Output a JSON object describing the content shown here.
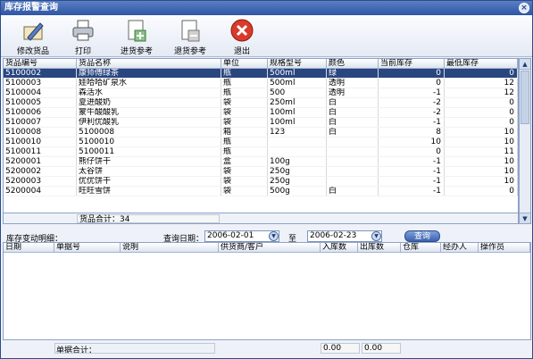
{
  "window": {
    "title": "库存报警查询",
    "close_icon": "close-icon"
  },
  "toolbar": {
    "buttons": [
      {
        "label": "修改货品",
        "icon": "edit-goods-icon"
      },
      {
        "label": "打印",
        "icon": "printer-icon"
      },
      {
        "label": "进货参考",
        "icon": "add-document-icon"
      },
      {
        "label": "退货参考",
        "icon": "remove-document-icon"
      },
      {
        "label": "退出",
        "icon": "exit-icon"
      }
    ]
  },
  "grid": {
    "columns": [
      "货品编号",
      "货品名称",
      "单位",
      "规格型号",
      "颜色",
      "当前库存",
      "最低库存"
    ],
    "rows": [
      [
        "5100002",
        "康师傅绿茶",
        "瓶",
        "500ml",
        "绿",
        "0",
        "0"
      ],
      [
        "5100003",
        "娃哈哈矿泉水",
        "瓶",
        "500ml",
        "透明",
        "0",
        "12"
      ],
      [
        "5100004",
        "森活水",
        "瓶",
        "500",
        "透明",
        "-1",
        "12"
      ],
      [
        "5100005",
        "夏进酸奶",
        "袋",
        "250ml",
        "白",
        "-2",
        "0"
      ],
      [
        "5100006",
        "蒙牛酸酸乳",
        "袋",
        "100ml",
        "白",
        "-2",
        "0"
      ],
      [
        "5100007",
        "伊利优酸乳",
        "袋",
        "100ml",
        "白",
        "-1",
        "0"
      ],
      [
        "5100008",
        "5100008",
        "箱",
        "123",
        "白",
        "8",
        "10"
      ],
      [
        "5100010",
        "5100010",
        "瓶",
        "",
        "",
        "10",
        "10"
      ],
      [
        "5100011",
        "5100011",
        "瓶",
        "",
        "",
        "0",
        "11"
      ],
      [
        "5200001",
        "熊仔饼干",
        "盒",
        "100g",
        "",
        "-1",
        "10"
      ],
      [
        "5200002",
        "太谷饼",
        "袋",
        "250g",
        "",
        "-1",
        "10"
      ],
      [
        "5200003",
        "优优饼干",
        "袋",
        "250g",
        "",
        "-1",
        "10"
      ],
      [
        "5200004",
        "旺旺雪饼",
        "袋",
        "500g",
        "白",
        "-1",
        "0"
      ]
    ],
    "summary": "货品合计：34"
  },
  "detail": {
    "label": "库存变动明细：",
    "date_label": "查询日期：",
    "date_from": "2006-02-01",
    "to_label": "至",
    "date_to": "2006-02-23",
    "query_label": "查询",
    "columns": [
      "日期",
      "单据号",
      "说明",
      "供货商/客户",
      "入库数",
      "出库数",
      "仓库",
      "经办人",
      "操作员"
    ],
    "summary_label": "单据合计：",
    "in_total": "0.00",
    "out_total": "0.00"
  }
}
